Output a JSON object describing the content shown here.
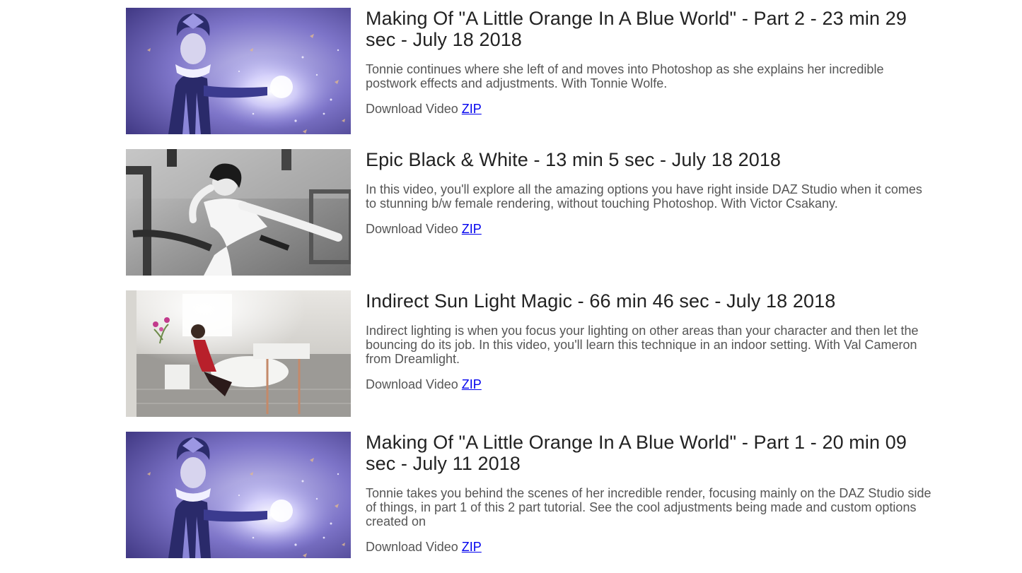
{
  "videos": [
    {
      "title": "Making Of \"A Little Orange In A Blue World\" - Part 2 - 23 min 29 sec - July 18 2018",
      "description": "Tonnie continues where she left of and moves into Photoshop as she explains her incredible postwork effects and adjustments. With Tonnie Wolfe.",
      "download_label": "Download Video",
      "link_label": "ZIP",
      "thumbnail": "harlequin-blue-render"
    },
    {
      "title": "Epic Black & White - 13 min 5 sec - July 18 2018",
      "description": "In this video, you'll explore all the amazing options you have right inside DAZ Studio when it comes to stunning b/w female rendering, without touching Photoshop. With Victor Csakany.",
      "download_label": "Download Video",
      "link_label": "ZIP",
      "thumbnail": "black-white-woman-render"
    },
    {
      "title": "Indirect Sun Light Magic - 66 min 46 sec - July 18 2018",
      "description": "Indirect lighting is when you focus your lighting on other areas than your character and then let the bouncing do its job. In this video, you'll learn this technique in an indoor setting. With Val Cameron from Dreamlight.",
      "download_label": "Download Video",
      "link_label": "ZIP",
      "thumbnail": "bathroom-sunlight-render"
    },
    {
      "title": "Making Of \"A Little Orange In A Blue World\" - Part 1 - 20 min 09 sec - July 11 2018",
      "description": "Tonnie takes you behind the scenes of her incredible render, focusing mainly on the DAZ Studio side of things, in part 1 of this 2 part tutorial. See the cool adjustments being made and custom options created on",
      "download_label": "Download Video",
      "link_label": "ZIP",
      "thumbnail": "harlequin-blue-render"
    }
  ],
  "colors": {
    "link": "#0000ee",
    "title": "#222222",
    "text": "#555555"
  }
}
